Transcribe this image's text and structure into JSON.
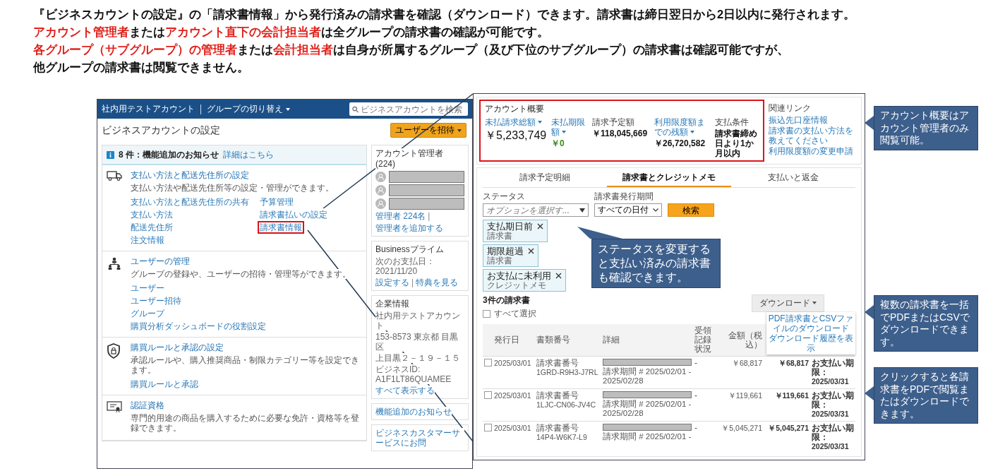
{
  "heading": {
    "lines": [
      [
        {
          "text": "『ビジネスカウントの設定』の「請求書情報」から発行済みの請求書を確認（ダウンロード）できます。請求書は締日翌日から2日以内に発行されます。",
          "highlight": false
        }
      ],
      [
        {
          "text": "アカウント管理者",
          "highlight": true
        },
        {
          "text": "または",
          "highlight": false
        },
        {
          "text": "アカウント直下の会計担当者",
          "highlight": true
        },
        {
          "text": "は全グループの請求書の確認が可能です。",
          "highlight": false
        }
      ],
      [
        {
          "text": "各グループ（サブグループ）の管理者",
          "highlight": true
        },
        {
          "text": "または",
          "highlight": false
        },
        {
          "text": "会計担当者",
          "highlight": true
        },
        {
          "text": "は自身が所属するグループ（及び下位のサブグループ）の請求書は確認可能ですが、",
          "highlight": false
        }
      ],
      [
        {
          "text": "他グループの請求書は閲覧できません。",
          "highlight": false
        }
      ]
    ]
  },
  "settings_screen": {
    "topbar": {
      "account": "社内用テストアカウント",
      "group_switch": "グループの切り替え",
      "search": {
        "placeholder": "ビジネスアカウントを検索"
      }
    },
    "title": "ビジネスアカウントの設定",
    "invite_button": "ユーザーを招待",
    "notice": {
      "count": "8 件：機能追加のお知らせ",
      "link": "詳細はこちら"
    },
    "sections": [
      {
        "kind": "truck",
        "title": "支払い方法と配送先住所の設定",
        "description": "支払い方法や配送先住所等の設定・管理ができます。",
        "links": [
          [
            {
              "label": "支払い方法と配送先住所の共有",
              "highlighted": false
            },
            {
              "label": "支払い方法",
              "highlighted": false
            },
            {
              "label": "配送先住所",
              "highlighted": false
            },
            {
              "label": "注文情報",
              "highlighted": false
            }
          ],
          [
            {
              "label": "予算管理",
              "highlighted": false
            },
            {
              "label": "請求書払いの設定",
              "highlighted": false
            },
            {
              "label": "請求書情報",
              "highlighted": true
            }
          ]
        ]
      },
      {
        "kind": "users",
        "title": "ユーザーの管理",
        "description": "グループの登録や、ユーザーの招待・管理等ができます。",
        "links": [
          [
            {
              "label": "ユーザー",
              "highlighted": false
            },
            {
              "label": "ユーザー招待",
              "highlighted": false
            },
            {
              "label": "グループ",
              "highlighted": false
            },
            {
              "label": "購買分析ダッシュボードの役割設定",
              "highlighted": false
            }
          ]
        ]
      },
      {
        "kind": "shield",
        "title": "購買ルールと承認の設定",
        "description": "承認ルールや、購入推奨商品・制限カテゴリー等を設定できます。",
        "links": [
          [
            {
              "label": "購買ルールと承認",
              "highlighted": false
            }
          ]
        ]
      },
      {
        "kind": "certificate",
        "title": "認証資格",
        "description": "専門的用途の商品を購入するために必要な免許・資格等を登録できます。"
      }
    ],
    "side": {
      "admins": {
        "title": "アカウント管理者 (224)",
        "links": [
          "管理者 224名",
          "管理者を追加する"
        ],
        "separator": "|"
      },
      "prime": {
        "title": "Businessプライム",
        "next_payment": "次のお支払日：2021/11/20",
        "links": [
          "設定する",
          "特典を見る"
        ],
        "separator": "|"
      },
      "company": {
        "title": "企業情報",
        "lines": [
          "社内用テストアカウント",
          "153-8573 東京都 目黒区",
          "上目黒２－１９－１５",
          "ビジネスID: A1F1LT86QUAMEE"
        ],
        "link": "すべて表示する"
      },
      "news_link": "機能追加のお知らせ",
      "support_link": "ビジネスカスタマーサービスにお問"
    }
  },
  "invoice_screen": {
    "overview": {
      "title": "アカウント概要",
      "highlighted": true,
      "metrics": [
        {
          "label": "未払請求総額",
          "dropdown": true,
          "value": "￥5,233,749",
          "color": "#111111"
        },
        {
          "label": "未払期限額",
          "dropdown": true,
          "value": "￥0",
          "color": "#3a8a1c"
        },
        {
          "label": "請求予定額",
          "dropdown": false,
          "value": "￥118,045,669",
          "color": "#111111"
        },
        {
          "label": "利用限度額までの残額",
          "dropdown": true,
          "value": "￥26,720,582",
          "color": "#111111"
        },
        {
          "label": "支払条件",
          "dropdown": false,
          "value": "請求書締め日より1か月以内",
          "color": "#111111"
        }
      ],
      "related": {
        "title": "関連リンク",
        "links": [
          "振込先口座情報",
          "請求書の支払い方法を教えてください",
          "利用限度額の変更申請"
        ]
      }
    },
    "tabs": [
      {
        "label": "請求予定明細",
        "selected": false
      },
      {
        "label": "請求書とクレジットメモ",
        "selected": true
      },
      {
        "label": "支払いと返金",
        "selected": false
      }
    ],
    "filters": {
      "status": {
        "label": "ステータス",
        "placeholder": "オプションを選択す..."
      },
      "period": {
        "label": "請求書発行期間",
        "value": "すべての日付"
      },
      "search_button": "検索"
    },
    "chips": [
      {
        "title": "支払期日前",
        "subtitle": "請求書"
      },
      {
        "title": "期限超過",
        "subtitle": "請求書"
      },
      {
        "title": "お支払に未利用",
        "subtitle": "クレジットメモ"
      }
    ],
    "count": "3件の請求書",
    "select_all": {
      "label": "すべて選択",
      "checked": false
    },
    "download": {
      "label": "ダウンロード",
      "menu": [
        "PDF請求書とCSVファイルのダウンロード",
        "ダウンロード履歴を表示"
      ]
    },
    "table": {
      "columns": [
        "発行日",
        "書類番号",
        "詳細",
        "受領記録状況",
        "金額（税込）"
      ],
      "rows": [
        {
          "checked": false,
          "date": "2025/03/01",
          "doc_label": "請求書番号",
          "doc_number": "1GRD-R9H3-J7RL",
          "detail": "請求期間 # 2025/02/01 - 2025/02/28",
          "receipt": "-",
          "amount": "￥68,817",
          "total": "￥68,817",
          "due_label": "お支払い期限：",
          "due_date": "2025/03/31"
        },
        {
          "checked": false,
          "date": "2025/03/01",
          "doc_label": "請求書番号",
          "doc_number": "1LJC-CN06-JV4C",
          "detail": "請求期間 # 2025/02/01 - 2025/02/28",
          "receipt": "-",
          "amount": "￥119,661",
          "total": "￥119,661",
          "due_label": "お支払い期限：",
          "due_date": "2025/03/31"
        },
        {
          "checked": false,
          "date": "2025/03/01",
          "doc_label": "請求書番号",
          "doc_number": "14P4-W6K7-L9",
          "detail": "請求期間 # 2025/02/01 -",
          "receipt": "-",
          "amount": "￥5,045,271",
          "total": "￥5,045,271",
          "due_label": "お支払い期限：",
          "due_date": "2025/03/31"
        }
      ]
    }
  },
  "callouts": [
    {
      "text": "アカウント概要はアカウント管理者のみ閲覧可能。"
    },
    {
      "text": "ステータスを変更すると支払い済みの請求書も確認できます。"
    },
    {
      "text": "複数の請求書を一括でPDFまたはCSVでダウンロードできます。"
    },
    {
      "text": "クリックすると各請求書をPDFで閲覧またはダウンロードできます。"
    }
  ]
}
